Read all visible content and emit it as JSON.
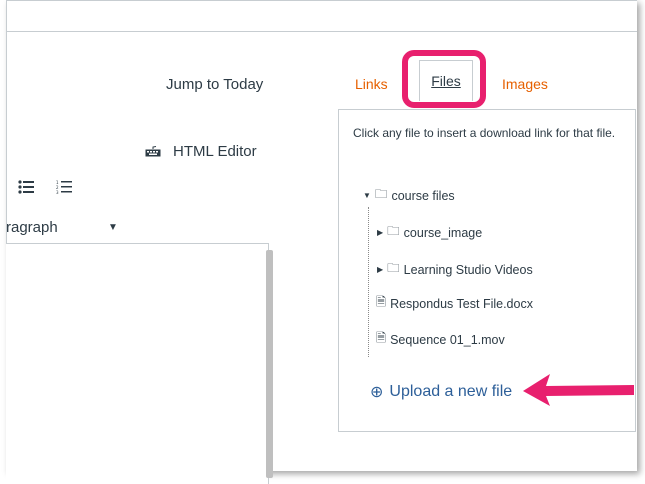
{
  "header": {
    "jump_to_today": "Jump to Today",
    "html_editor": "HTML Editor"
  },
  "toolbar": {
    "paragraph": "ragraph"
  },
  "tabs": [
    {
      "label": "Links"
    },
    {
      "label": "Files"
    },
    {
      "label": "Images"
    }
  ],
  "files_panel": {
    "hint": "Click any file to insert a download link for that file.",
    "tree": {
      "root": "course files",
      "children": [
        {
          "label": "course_image",
          "type": "folder"
        },
        {
          "label": "Learning Studio Videos",
          "type": "folder"
        },
        {
          "label": "Respondus Test File.docx",
          "type": "file"
        },
        {
          "label": "Sequence 01_1.mov",
          "type": "file"
        }
      ]
    },
    "upload_label": "Upload a new file"
  },
  "colors": {
    "tab_link": "#e66000",
    "highlight": "#e8206e",
    "upload_link": "#2d5f99"
  },
  "icons": [
    "keyboard-icon",
    "bullet-list-icon",
    "numbered-list-icon",
    "folder-icon",
    "document-icon",
    "plus-circle-icon"
  ]
}
